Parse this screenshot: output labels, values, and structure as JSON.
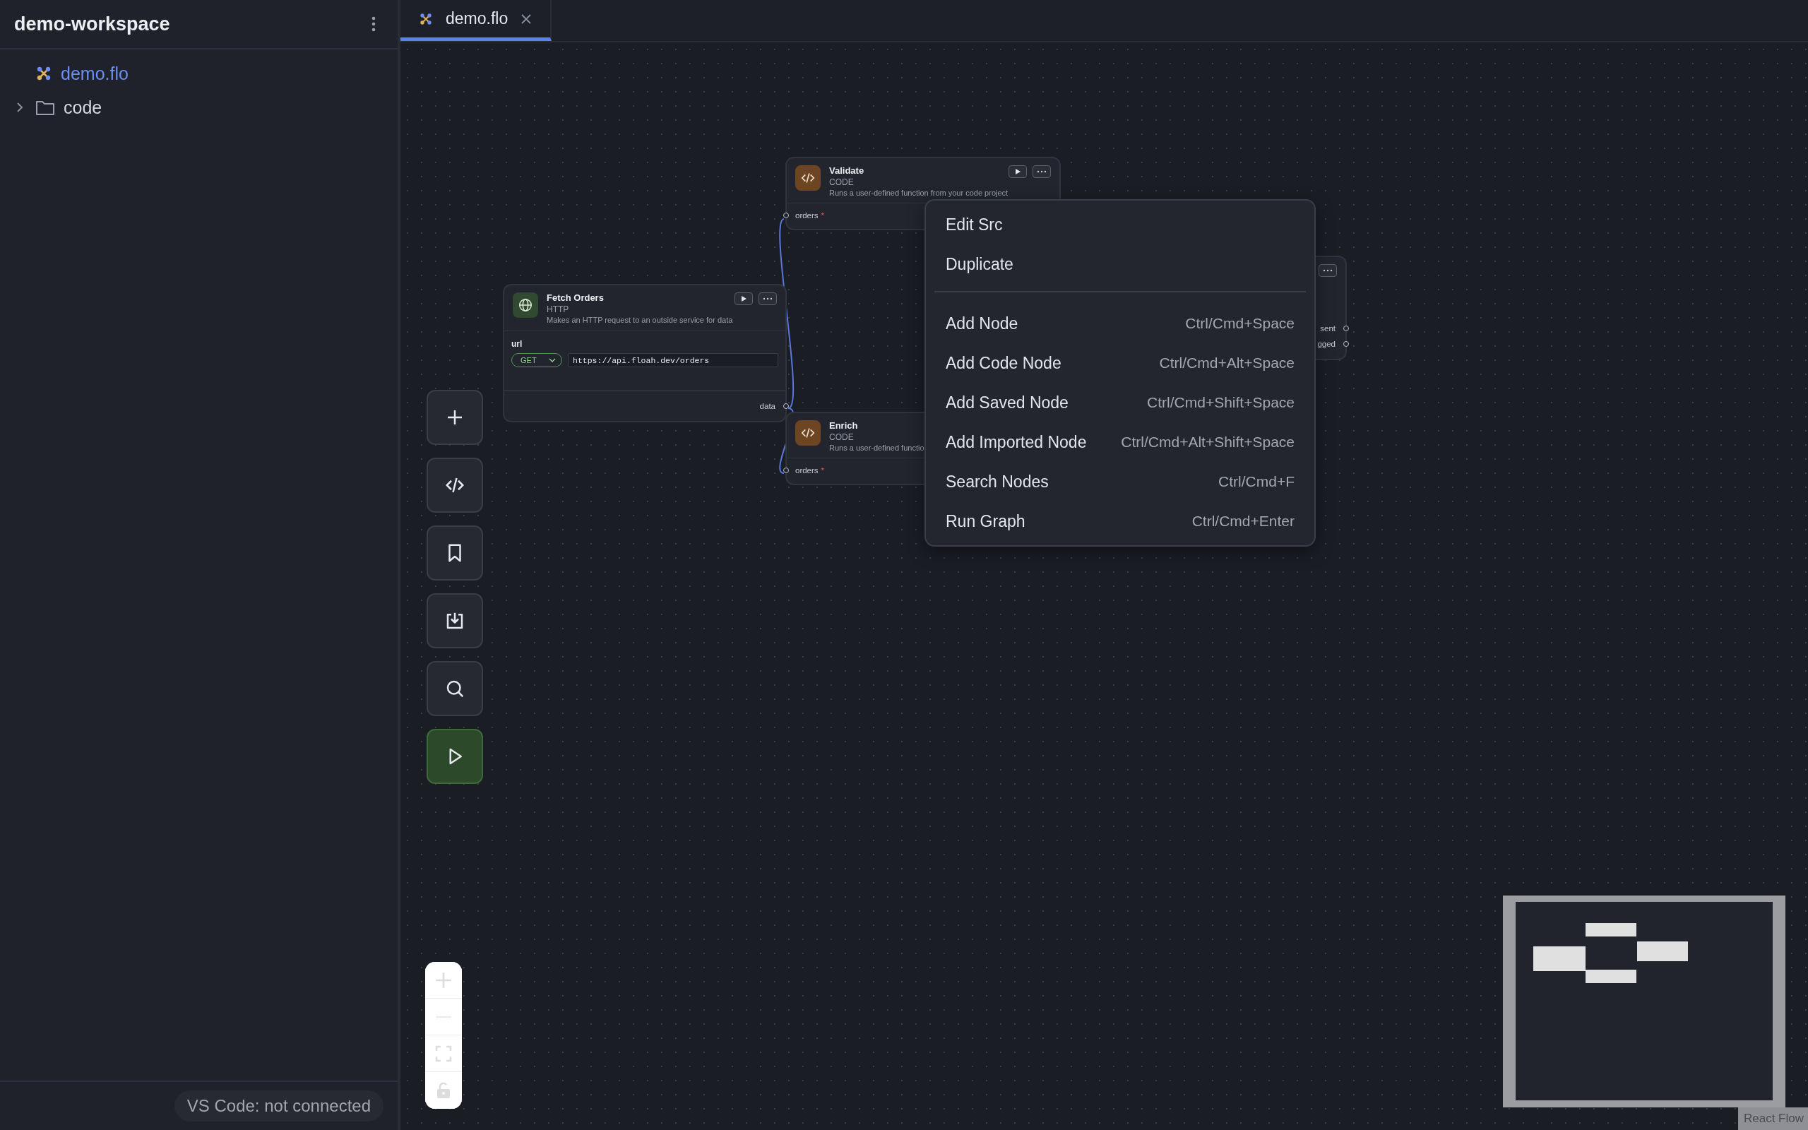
{
  "sidebar": {
    "title": "demo-workspace",
    "items": [
      {
        "label": "demo.flo",
        "kind": "flow",
        "selected": true
      },
      {
        "label": "code",
        "kind": "folder",
        "selected": false,
        "expanded": false
      }
    ]
  },
  "status": {
    "text": "VS Code: not connected"
  },
  "tabs": [
    {
      "label": "demo.flo",
      "selected": true
    }
  ],
  "toolbar": [
    {
      "kind": "add"
    },
    {
      "kind": "code"
    },
    {
      "kind": "bookmark"
    },
    {
      "kind": "import"
    },
    {
      "kind": "search"
    },
    {
      "kind": "run"
    }
  ],
  "nodes": [
    {
      "kind": "code",
      "title": "Validate",
      "type": "CODE",
      "description": "Runs a user-defined function from your code project",
      "run_button": true,
      "more_button": true,
      "inputs": [
        {
          "label": "orders",
          "mark": "*"
        }
      ]
    },
    {
      "kind": "http",
      "title": "Fetch Orders",
      "type": "HTTP",
      "description": "Makes an HTTP request to an outside service for data",
      "run_button": true,
      "more_button": true,
      "fields": [
        {
          "label": "url",
          "method": "GET",
          "value": "https://api.floah.dev/orders"
        }
      ],
      "outputs": [
        {
          "label": "data"
        }
      ]
    },
    {
      "kind": "code",
      "title": "Enrich",
      "type": "CODE",
      "description": "Runs a user-defined functio",
      "inputs": [
        {
          "label": "orders",
          "mark": "*"
        }
      ]
    },
    {
      "kind": "hidden",
      "more_button": true,
      "outputs": [
        {
          "label": "sent"
        },
        {
          "label": "gged"
        }
      ]
    }
  ],
  "context_menu": {
    "items": [
      {
        "kind": "item",
        "label": "Edit Src"
      },
      {
        "kind": "item",
        "label": "Duplicate"
      },
      {
        "kind": "separator"
      },
      {
        "kind": "item",
        "label": "Add Node",
        "shortcut": "Ctrl/Cmd+Space"
      },
      {
        "kind": "item",
        "label": "Add Code Node",
        "shortcut": "Ctrl/Cmd+Alt+Space"
      },
      {
        "kind": "item",
        "label": "Add Saved Node",
        "shortcut": "Ctrl/Cmd+Shift+Space"
      },
      {
        "kind": "item",
        "label": "Add Imported Node",
        "shortcut": "Ctrl/Cmd+Alt+Shift+Space"
      },
      {
        "kind": "item",
        "label": "Search Nodes",
        "shortcut": "Ctrl/Cmd+F"
      },
      {
        "kind": "item",
        "label": "Run Graph",
        "shortcut": "Ctrl/Cmd+Enter"
      }
    ]
  },
  "zoom_controls": [
    {
      "kind": "zoom-in"
    },
    {
      "kind": "zoom-out"
    },
    {
      "kind": "fit"
    },
    {
      "kind": "lock"
    }
  ],
  "attribution": "React Flow"
}
